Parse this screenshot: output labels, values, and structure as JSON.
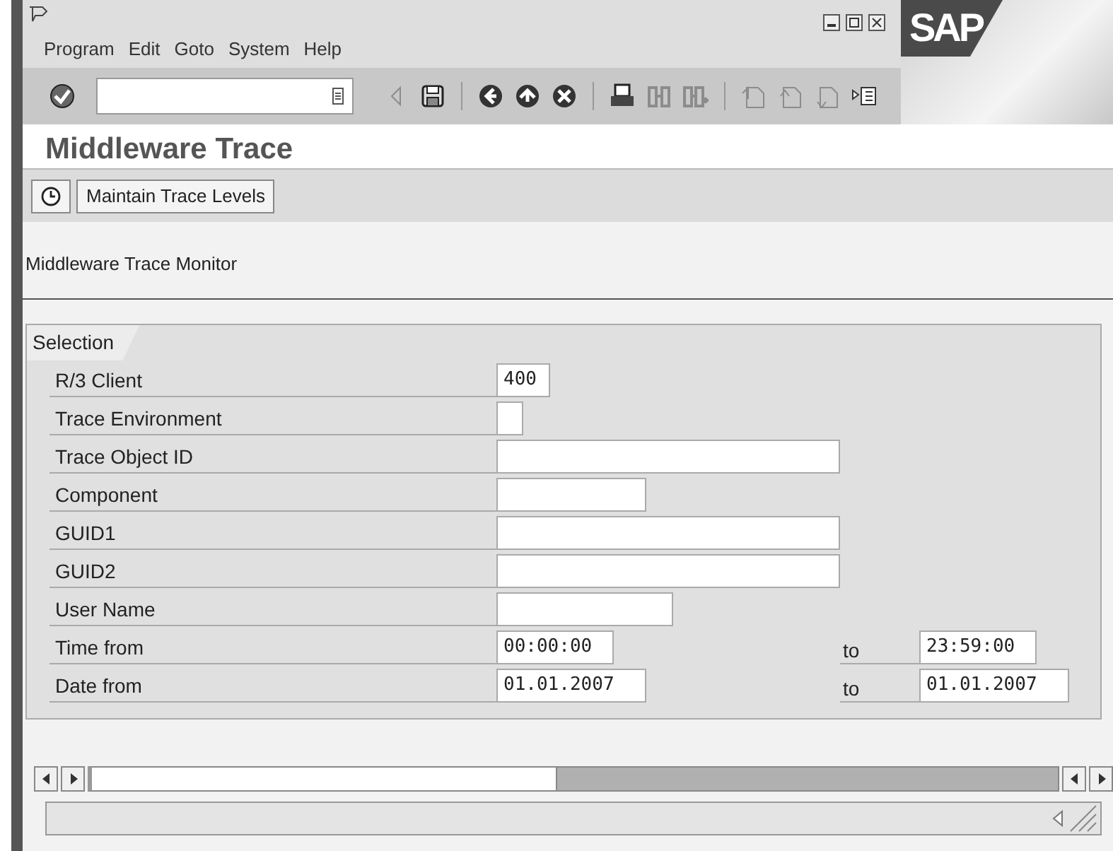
{
  "menu": [
    "Program",
    "Edit",
    "Goto",
    "System",
    "Help"
  ],
  "logo": "SAP",
  "toolbar": [
    {
      "kind": "enter",
      "disabled": false
    },
    {
      "kind": "command-field"
    },
    {
      "kind": "back-arrow",
      "disabled": true
    },
    {
      "kind": "save",
      "disabled": false
    },
    {
      "kind": "sep"
    },
    {
      "kind": "back",
      "disabled": false
    },
    {
      "kind": "exit",
      "disabled": false
    },
    {
      "kind": "cancel",
      "disabled": false
    },
    {
      "kind": "sep"
    },
    {
      "kind": "print",
      "disabled": false
    },
    {
      "kind": "find",
      "disabled": true
    },
    {
      "kind": "find-next",
      "disabled": true
    },
    {
      "kind": "sep"
    },
    {
      "kind": "first-page",
      "disabled": true
    },
    {
      "kind": "prev-page",
      "disabled": true
    },
    {
      "kind": "next-page",
      "disabled": true
    },
    {
      "kind": "layout",
      "disabled": false
    }
  ],
  "title": "Middleware Trace",
  "app_toolbar": [
    {
      "kind": "icon"
    },
    {
      "kind": "text",
      "label": "Maintain Trace Levels"
    }
  ],
  "subtitle": "Middleware Trace Monitor",
  "group": {
    "title": "Selection",
    "fields": [
      {
        "label": "R/3 Client",
        "value": "400",
        "kind": "tiny"
      },
      {
        "label": "Trace Environment",
        "kind": "char"
      },
      {
        "label": "Trace Object ID",
        "kind": "long"
      },
      {
        "label": "Component",
        "kind": "medium"
      },
      {
        "label": "GUID1",
        "kind": "long"
      },
      {
        "label": "GUID2",
        "kind": "long"
      },
      {
        "label": "User Name",
        "kind": "wide"
      },
      {
        "label": "Time from",
        "value": "00:00:00",
        "kind": "time",
        "to_label": "to",
        "to_value": "23:59:00"
      },
      {
        "label": "Date from",
        "value": "01.01.2007",
        "kind": "date",
        "to_label": "to",
        "to_value": "01.01.2007"
      }
    ]
  }
}
